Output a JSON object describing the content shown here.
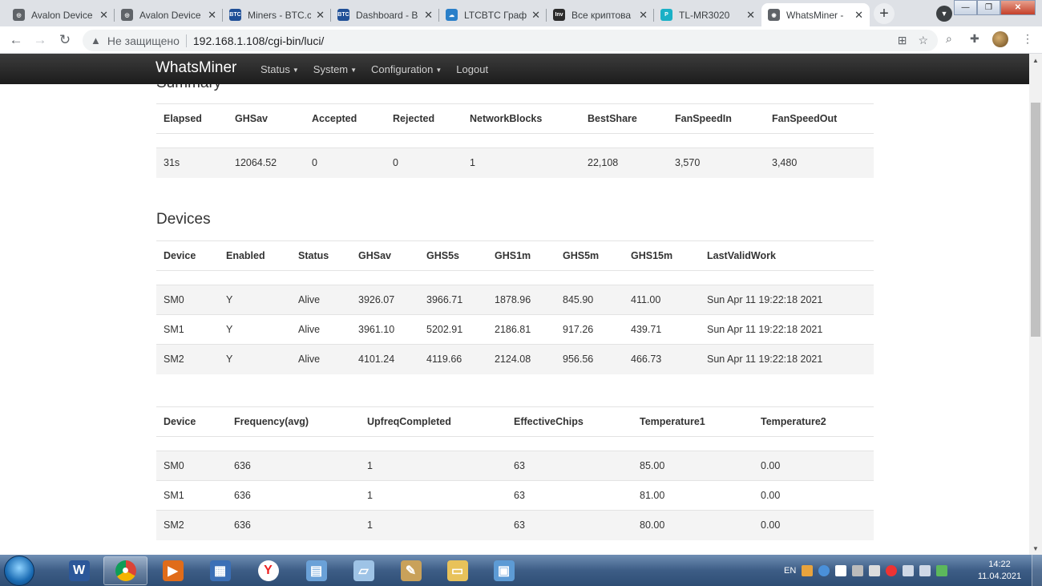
{
  "browser": {
    "tabs": [
      {
        "title": "Avalon Device",
        "fav_color": "#5f6368",
        "fav_text": "◎"
      },
      {
        "title": "Avalon Device",
        "fav_color": "#5f6368",
        "fav_text": "◎"
      },
      {
        "title": "Miners - BTC.c",
        "fav_color": "#1f4f97",
        "fav_text": "BTC"
      },
      {
        "title": "Dashboard - B",
        "fav_color": "#1f4f97",
        "fav_text": "BTC"
      },
      {
        "title": "LTCBTC Графи",
        "fav_color": "#2a7fc9",
        "fav_text": "☁"
      },
      {
        "title": "Все криптова",
        "fav_color": "#2b2b2b",
        "fav_text": "Inv"
      },
      {
        "title": "TL-MR3020",
        "fav_color": "#1ab0c6",
        "fav_text": "P"
      },
      {
        "title": "WhatsMiner -",
        "fav_color": "#5f6368",
        "fav_text": "◉"
      }
    ],
    "security_label": "Не защищено",
    "url": "192.168.1.108/cgi-bin/luci/"
  },
  "navbar": {
    "brand": "WhatsMiner",
    "menu": [
      {
        "label": "Status"
      },
      {
        "label": "System"
      },
      {
        "label": "Configuration"
      },
      {
        "label": "Logout"
      }
    ]
  },
  "summary": {
    "heading": "Summary",
    "columns": [
      "Elapsed",
      "GHSav",
      "Accepted",
      "Rejected",
      "NetworkBlocks",
      "BestShare",
      "FanSpeedIn",
      "FanSpeedOut"
    ],
    "rows": [
      [
        "31s",
        "12064.52",
        "0",
        "0",
        "1",
        "22,108",
        "3,570",
        "3,480"
      ]
    ]
  },
  "devices": {
    "heading": "Devices",
    "columns": [
      "Device",
      "Enabled",
      "Status",
      "GHSav",
      "GHS5s",
      "GHS1m",
      "GHS5m",
      "GHS15m",
      "LastValidWork"
    ],
    "rows": [
      [
        "SM0",
        "Y",
        "Alive",
        "3926.07",
        "3966.71",
        "1878.96",
        "845.90",
        "411.00",
        "Sun Apr 11 19:22:18 2021"
      ],
      [
        "SM1",
        "Y",
        "Alive",
        "3961.10",
        "5202.91",
        "2186.81",
        "917.26",
        "439.71",
        "Sun Apr 11 19:22:18 2021"
      ],
      [
        "SM2",
        "Y",
        "Alive",
        "4101.24",
        "4119.66",
        "2124.08",
        "956.56",
        "466.73",
        "Sun Apr 11 19:22:18 2021"
      ]
    ]
  },
  "chips": {
    "columns": [
      "Device",
      "Frequency(avg)",
      "UpfreqCompleted",
      "EffectiveChips",
      "Temperature1",
      "Temperature2"
    ],
    "rows": [
      [
        "SM0",
        "636",
        "1",
        "63",
        "85.00",
        "0.00"
      ],
      [
        "SM1",
        "636",
        "1",
        "63",
        "81.00",
        "0.00"
      ],
      [
        "SM2",
        "636",
        "1",
        "63",
        "80.00",
        "0.00"
      ]
    ]
  },
  "taskbar": {
    "apps": [
      {
        "name": "word",
        "color": "#2b579a",
        "glyph": "W"
      },
      {
        "name": "chrome",
        "color": "#db4437",
        "glyph": "●"
      },
      {
        "name": "media-player",
        "color": "#e06c1a",
        "glyph": "▶"
      },
      {
        "name": "network",
        "color": "#3b6fb6",
        "glyph": "▦"
      },
      {
        "name": "yandex",
        "color": "#ffffff",
        "glyph": "Y"
      },
      {
        "name": "control-panel",
        "color": "#6aa1d8",
        "glyph": "▤"
      },
      {
        "name": "notepad",
        "color": "#9ec3e6",
        "glyph": "▱"
      },
      {
        "name": "paint",
        "color": "#c9a15a",
        "glyph": "✎"
      },
      {
        "name": "explorer",
        "color": "#e8c25a",
        "glyph": "▭"
      },
      {
        "name": "display",
        "color": "#5d9bd5",
        "glyph": "▣"
      }
    ],
    "lang": "EN",
    "time": "14:22",
    "date": "11.04.2021"
  }
}
